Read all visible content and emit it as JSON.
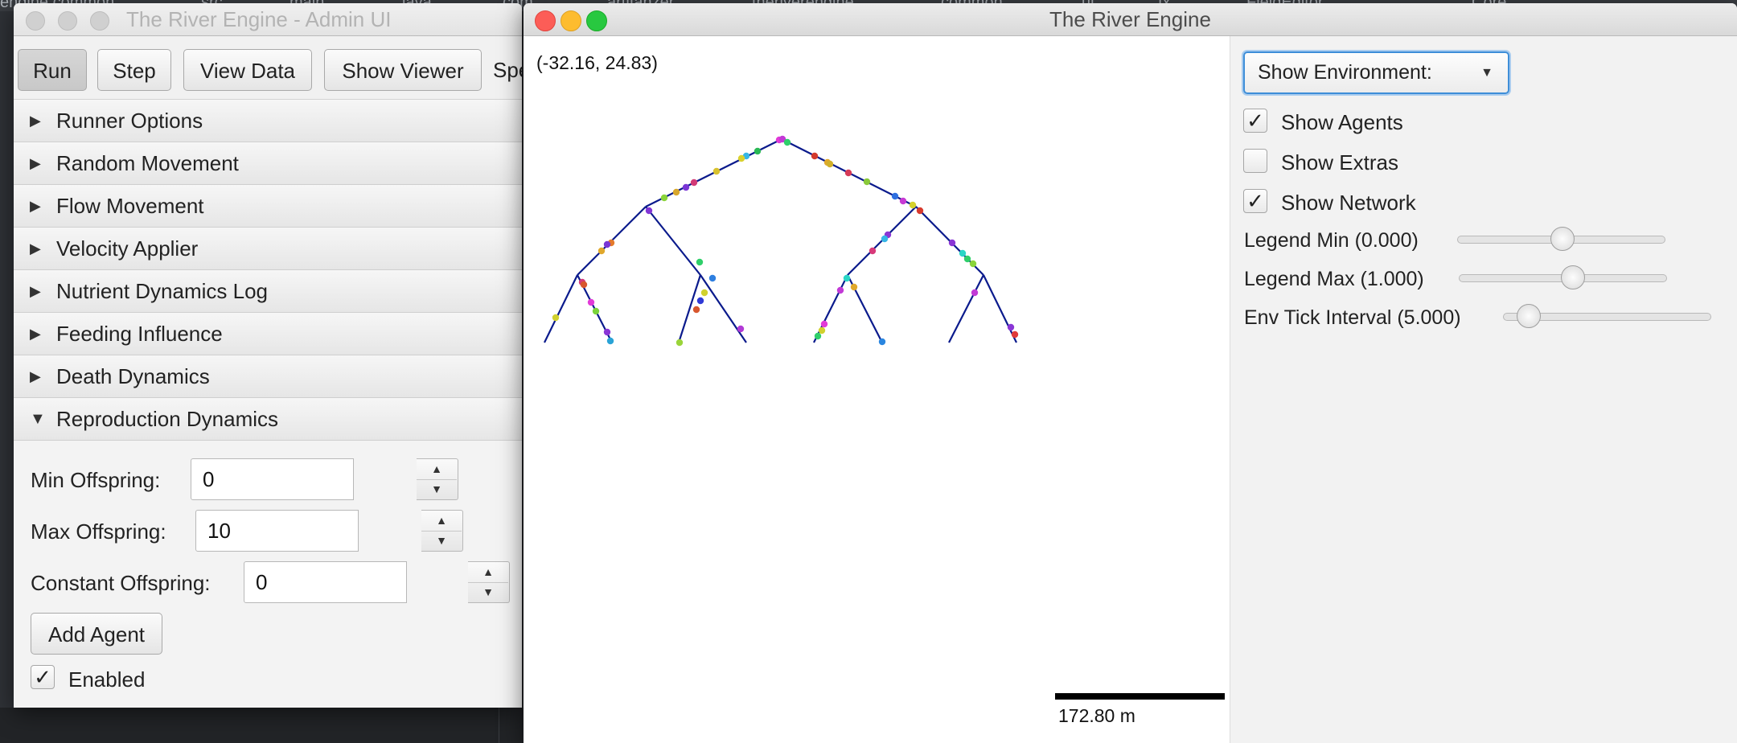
{
  "ide": {
    "breadcrumb": [
      "engine.common",
      "src",
      "main",
      "java",
      "com",
      "artifanzer",
      "theriverengine",
      "common",
      "ui",
      "fx",
      "FieldEditor",
      "Core"
    ]
  },
  "admin": {
    "title": "The River Engine - Admin UI",
    "toolbar": {
      "run": "Run",
      "step": "Step",
      "view_data": "View Data",
      "show_viewer": "Show Viewer",
      "clipped": "Spe"
    },
    "sections": [
      {
        "label": "Runner Options",
        "expanded": false
      },
      {
        "label": "Random Movement",
        "expanded": false
      },
      {
        "label": "Flow Movement",
        "expanded": false
      },
      {
        "label": "Velocity Applier",
        "expanded": false
      },
      {
        "label": "Nutrient Dynamics Log",
        "expanded": false
      },
      {
        "label": "Feeding Influence",
        "expanded": false
      },
      {
        "label": "Death Dynamics",
        "expanded": false
      },
      {
        "label": "Reproduction Dynamics",
        "expanded": true
      }
    ],
    "repro": {
      "min_label": "Min Offspring:",
      "min_value": "0",
      "max_label": "Max Offspring:",
      "max_value": "10",
      "const_label": "Constant Offspring:",
      "const_value": "0",
      "add_agent": "Add Agent",
      "enabled_label": "Enabled",
      "enabled_checked": true
    }
  },
  "river": {
    "title": "The River Engine",
    "coord": "(-32.16, 24.83)",
    "scale_label": "172.80 m",
    "colors": {
      "network": "#0a1a8c"
    },
    "panel": {
      "env_dropdown": "Show Environment:",
      "show_agents": "Show Agents",
      "show_agents_checked": true,
      "show_extras": "Show Extras",
      "show_extras_checked": false,
      "show_network": "Show Network",
      "show_network_checked": true,
      "legend_min": "Legend Min (0.000)",
      "legend_max": "Legend Max (1.000)",
      "env_tick": "Env Tick Interval (5.000)"
    }
  }
}
